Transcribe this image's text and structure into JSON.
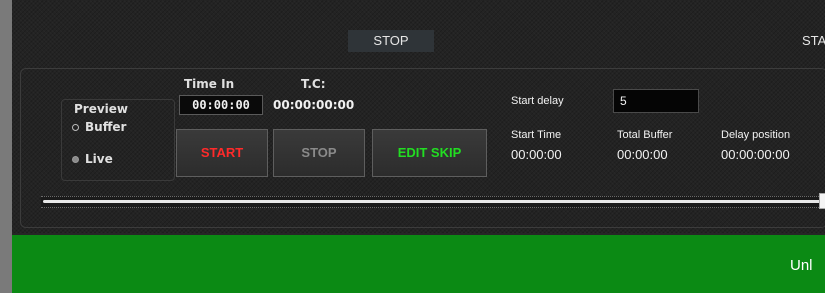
{
  "status_bar": {
    "stop_label": "STOP",
    "start_label": "STA"
  },
  "preview": {
    "title": "Preview",
    "options": [
      {
        "label": "Buffer",
        "selected": false
      },
      {
        "label": "Live",
        "selected": true
      }
    ]
  },
  "time_in": {
    "label": "Time In",
    "value": "00:00:00"
  },
  "tc": {
    "label": "T.C:",
    "value": "00:00:00:00"
  },
  "buttons": {
    "start": "START",
    "stop": "STOP",
    "edit_skip": "EDIT SKIP"
  },
  "start_delay": {
    "label": "Start delay",
    "value": "5"
  },
  "start_time": {
    "label": "Start Time",
    "value": "00:00:00"
  },
  "total_buffer": {
    "label": "Total Buffer",
    "value": "00:00:00"
  },
  "delay_position": {
    "label": "Delay position",
    "value": "00:00:00:00"
  },
  "slider": {
    "position_fraction": 1.0
  },
  "footer": {
    "text": "Unl",
    "color": "#0b8a14"
  },
  "colors": {
    "start_button": "#ff2a2a",
    "stop_button": "#8a8a8a",
    "edit_skip_button": "#22dd22"
  }
}
